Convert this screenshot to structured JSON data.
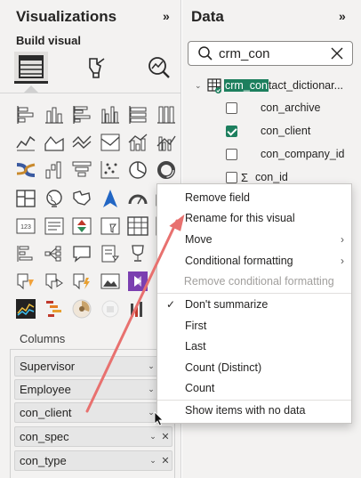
{
  "visualizations": {
    "title": "Visualizations",
    "collapse_glyph": "»",
    "build_visual_label": "Build visual",
    "tabs": [
      {
        "name": "build-visual-tab",
        "icon": "table-grid-icon",
        "active": true
      },
      {
        "name": "format-visual-tab",
        "icon": "paintbrush-icon",
        "active": false
      },
      {
        "name": "analytics-tab",
        "icon": "magnifier-chart-icon",
        "active": false
      }
    ],
    "columns_label": "Columns",
    "column_fields": [
      {
        "name": "Supervisor",
        "removable": false
      },
      {
        "name": "Employee",
        "removable": false
      },
      {
        "name": "con_client",
        "removable": false
      },
      {
        "name": "con_spec",
        "removable": true
      },
      {
        "name": "con_type",
        "removable": true
      }
    ]
  },
  "data": {
    "title": "Data",
    "collapse_glyph": "»",
    "search": {
      "value": "crm_con",
      "clear_glyph": "✕"
    },
    "table": {
      "name_highlight": "crm_con",
      "name_rest": "tact_dictionar..."
    },
    "fields": [
      {
        "label": "con_archive",
        "checked": false,
        "sigma": false
      },
      {
        "label": "con_client",
        "checked": true,
        "sigma": false
      },
      {
        "label": "con_company_id",
        "checked": false,
        "sigma": false
      },
      {
        "label": "con_id",
        "checked": false,
        "sigma": true
      }
    ],
    "sigma_glyph": "Σ"
  },
  "context_menu": {
    "items": [
      {
        "label": "Remove field",
        "disabled": false,
        "submenu": false,
        "checked": false
      },
      {
        "label": "Rename for this visual",
        "disabled": false,
        "submenu": false,
        "checked": false
      },
      {
        "label": "Move",
        "disabled": false,
        "submenu": true,
        "checked": false
      },
      {
        "label": "Conditional formatting",
        "disabled": false,
        "submenu": true,
        "checked": false
      },
      {
        "label": "Remove conditional formatting",
        "disabled": true,
        "submenu": false,
        "checked": false
      },
      {
        "label": "Don't summarize",
        "disabled": false,
        "submenu": false,
        "checked": true
      },
      {
        "label": "First",
        "disabled": false,
        "submenu": false,
        "checked": false
      },
      {
        "label": "Last",
        "disabled": false,
        "submenu": false,
        "checked": false
      },
      {
        "label": "Count (Distinct)",
        "disabled": false,
        "submenu": false,
        "checked": false
      },
      {
        "label": "Count",
        "disabled": false,
        "submenu": false,
        "checked": false
      },
      {
        "label": "Show items with no data",
        "disabled": false,
        "submenu": false,
        "checked": false
      }
    ],
    "check_glyph": "✓",
    "submenu_glyph": "›"
  },
  "colors": {
    "accent_green": "#1d7f5e",
    "annotation_arrow": "#e8716f",
    "pane_bg": "#f3f2f1"
  }
}
